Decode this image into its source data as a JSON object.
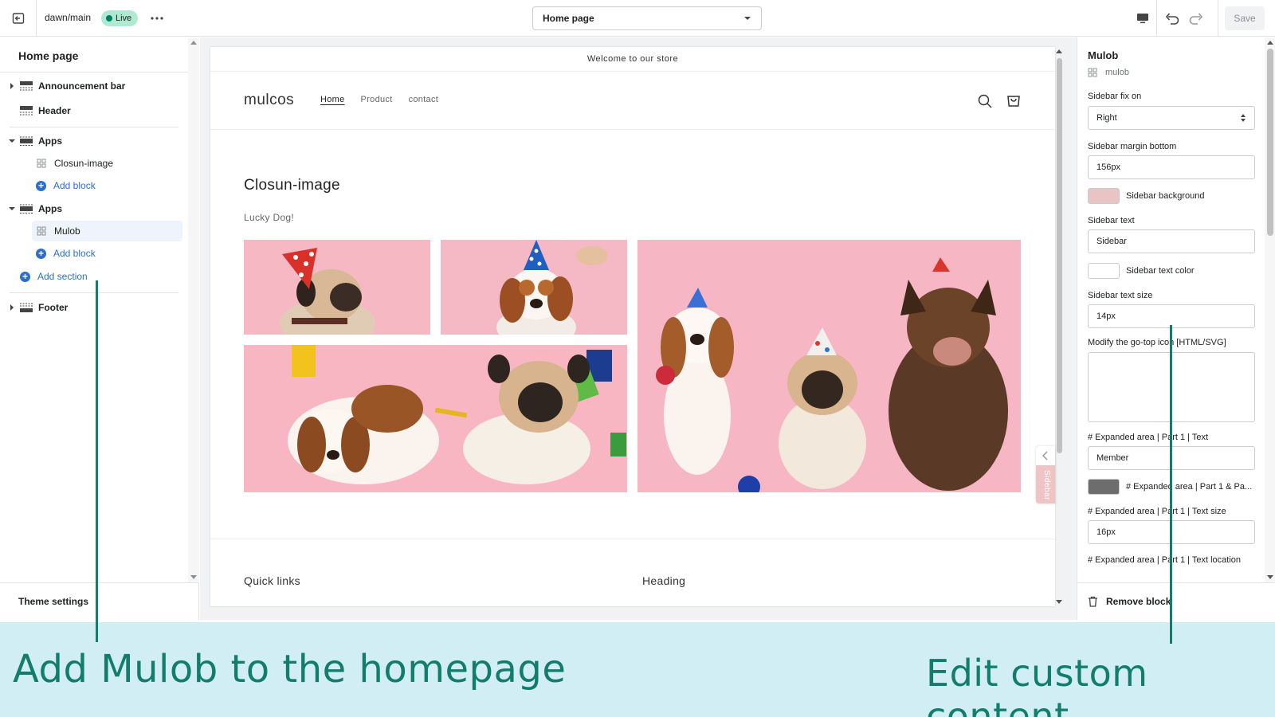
{
  "topbar": {
    "theme_name": "dawn/main",
    "live_badge": "Live",
    "page_select": "Home page",
    "save_label": "Save"
  },
  "left_panel": {
    "title": "Home page",
    "items": [
      {
        "label": "Announcement bar"
      },
      {
        "label": "Header"
      },
      {
        "label": "Apps"
      },
      {
        "label": "Closun-image"
      },
      {
        "label": "Add block"
      },
      {
        "label": "Apps"
      },
      {
        "label": "Mulob"
      },
      {
        "label": "Add block"
      },
      {
        "label": "Add section"
      },
      {
        "label": "Footer"
      }
    ],
    "theme_settings": "Theme settings"
  },
  "preview": {
    "announcement": "Welcome to our store",
    "store_name": "mulcos",
    "nav": [
      "Home",
      "Product",
      "contact"
    ],
    "section_title": "Closun-image",
    "section_subtitle": "Lucky Dog!",
    "footer_col1": "Quick links",
    "footer_col2": "Heading",
    "sidebar_tab": "Sidebar"
  },
  "right_panel": {
    "title": "Mulob",
    "subtitle": "mulob",
    "fields": {
      "fix_on_label": "Sidebar fix on",
      "fix_on_value": "Right",
      "margin_label": "Sidebar margin bottom",
      "margin_value": "156px",
      "bg_label": "Sidebar background",
      "text_label": "Sidebar text",
      "text_value": "Sidebar",
      "text_color_label": "Sidebar text color",
      "text_size_label": "Sidebar text size",
      "text_size_value": "14px",
      "icon_label": "Modify the go-top icon [HTML/SVG]",
      "exp_text_label": "# Expanded area | Part 1 | Text",
      "exp_text_value": "Member",
      "exp_color_label": "# Expanded area | Part 1 & Pa...",
      "exp_size_label": "# Expanded area | Part 1 | Text size",
      "exp_size_value": "16px",
      "exp_loc_label": "# Expanded area | Part 1 | Text location"
    },
    "remove_block": "Remove block"
  },
  "colors": {
    "sidebar_background": "#e8c4c4",
    "sidebar_text_color": "#ffffff",
    "expanded_color": "#6d6d6d",
    "accent": "#2c6ecb",
    "caption": "#117d6a"
  },
  "captions": {
    "left": "Add Mulob to the homepage",
    "right": "Edit custom content"
  }
}
